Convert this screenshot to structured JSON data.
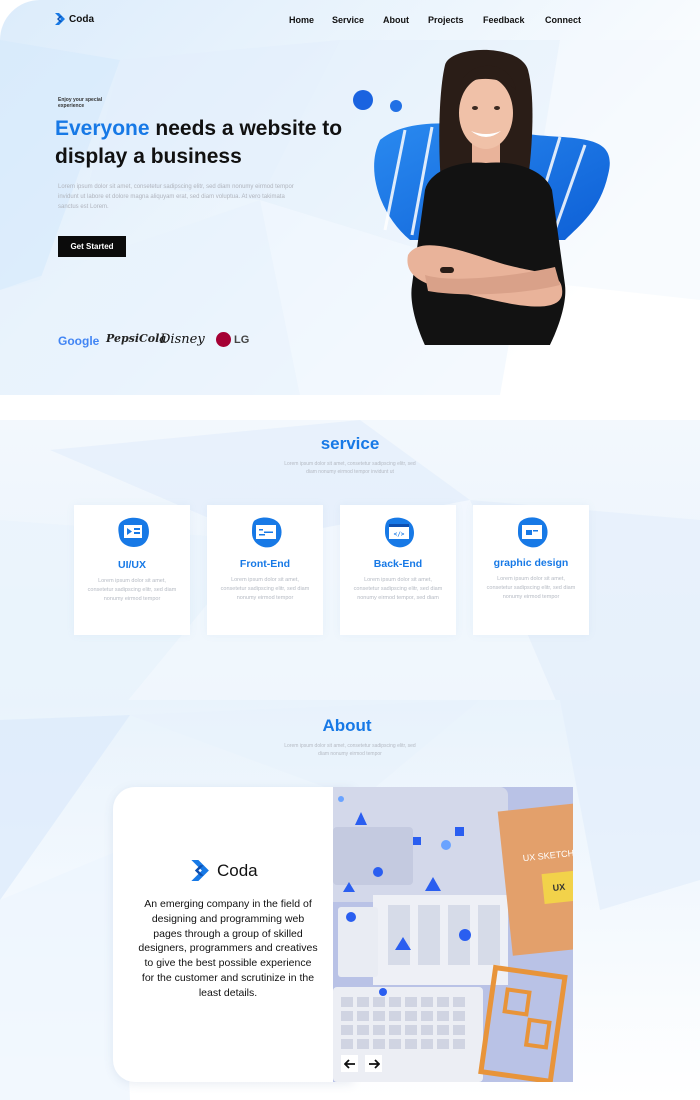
{
  "nav": {
    "logo": "Coda",
    "items": [
      "Home",
      "Service",
      "About",
      "Projects",
      "Feedback",
      "Connect"
    ]
  },
  "hero": {
    "eyebrow": "Enjoy your special experience",
    "headline_accent": "Everyone",
    "headline_rest": " needs a website to display a business",
    "description": "Lorem ipsum dolor sit amet, consetetur sadipscing elitr, sed diam nonumy eirmod tempor invidunt ut labore et dolore magna aliquyam erat, sed diam voluptua. At vero takimata sanctus est Lorem.",
    "cta": "Get Started",
    "brands": [
      "Google",
      "PepsiCola",
      "Disney",
      "LG"
    ]
  },
  "service": {
    "title": "service",
    "subtitle": "Lorem ipsum dolor sit amet, consetetur sadipscing elitr, sed diam nonumy eirmod tempor invidunt ut",
    "cards": [
      {
        "title": "UI/UX",
        "text": "Lorem ipsum dolor sit amet, consetetur sadipscing elitr, sed diam nonumy eirmod tempor",
        "icon": "ui-ux-icon"
      },
      {
        "title": "Front-End",
        "text": "Lorem ipsum dolor sit amet, consetetur sadipscing elitr, sed diam nonumy eirmod tempor",
        "icon": "front-end-icon"
      },
      {
        "title": "Back-End",
        "text": "Lorem ipsum dolor sit amet, consetetur sadipscing elitr, sed diam nonumy eirmod tempor, sed diam",
        "icon": "back-end-icon"
      },
      {
        "title": "graphic design",
        "text": "Lorem ipsum dolor sit amet, consetetur sadipscing elitr, sed diam nonumy eirmod tempor",
        "icon": "graphic-design-icon"
      }
    ]
  },
  "about": {
    "title": "About",
    "subtitle": "Lorem ipsum dolor sit amet, consetetur sadipscing elitr, sed diam nonumy eirmod tempor",
    "logo": "Coda",
    "text": "An emerging company in the field of designing and programming web pages through a group of skilled designers, programmers and creatives to give the best possible experience for the customer and scrutinize in the least details.",
    "photo_labels": [
      "UX SKETCH",
      "UX"
    ]
  },
  "colors": {
    "accent": "#1779e6",
    "dark": "#0b0b0b"
  }
}
